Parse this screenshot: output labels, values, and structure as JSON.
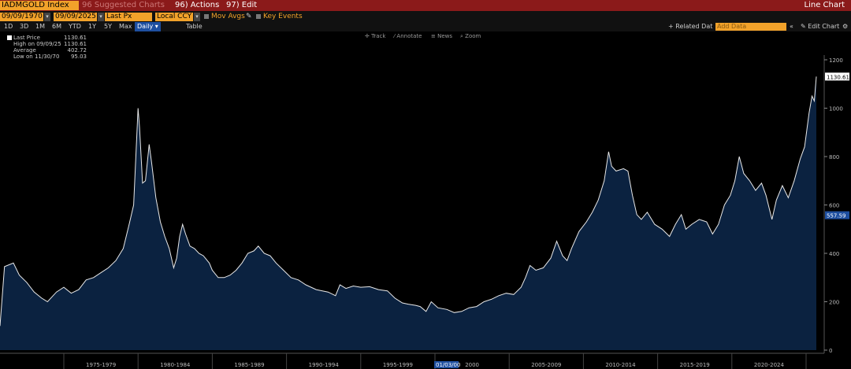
{
  "header": {
    "ticker": "IADMGOLD Index",
    "suggested": "96 Suggested Charts",
    "actions": "96) Actions",
    "edit": "97) Edit",
    "view_title": "Line Chart"
  },
  "controls": {
    "start_date": "09/09/1970",
    "end_date": "09/09/2025",
    "field": "Last Px",
    "currency": "Local CCY",
    "mov_avgs": "Mov Avgs",
    "key_events": "Key Events",
    "ranges": [
      "1D",
      "3D",
      "1M",
      "6M",
      "YTD",
      "1Y",
      "5Y",
      "Max"
    ],
    "frequency": "Daily",
    "table": "Table",
    "related_data": "+ Related Dat",
    "add_data_placeholder": "Add Data",
    "edit_chart": "Edit Chart"
  },
  "chart_tools": [
    "Track",
    "Annotate",
    "News",
    "Zoom"
  ],
  "legend": {
    "last_price_label": "Last Price",
    "last_price": "1130.61",
    "high_label": "High on 09/09/25",
    "high": "1130.61",
    "average_label": "Average",
    "average": "402.72",
    "low_label": "Low on 11/30/70",
    "low": "95.03"
  },
  "chart_data": {
    "type": "area",
    "x_tick_labels": [
      "1975-1979",
      "1980-1984",
      "1985-1989",
      "1990-1994",
      "1995-1999",
      "2000",
      "2005-2009",
      "2010-2014",
      "2015-2019",
      "2020-2024"
    ],
    "crosshair_date": "01/03/00",
    "y_ticks": [
      0,
      200,
      400,
      600,
      800,
      1000,
      1200
    ],
    "ylim": [
      0,
      1200
    ],
    "last_value_tag": "1130.61",
    "crosshair_value_tag": "557.59",
    "series": [
      {
        "points": [
          [
            1970.7,
            100
          ],
          [
            1971.0,
            345
          ],
          [
            1971.6,
            360
          ],
          [
            1972.0,
            310
          ],
          [
            1972.5,
            280
          ],
          [
            1973.0,
            240
          ],
          [
            1973.5,
            215
          ],
          [
            1973.9,
            200
          ],
          [
            1974.5,
            240
          ],
          [
            1975.0,
            260
          ],
          [
            1975.5,
            235
          ],
          [
            1976.0,
            250
          ],
          [
            1976.5,
            290
          ],
          [
            1977.0,
            300
          ],
          [
            1977.5,
            320
          ],
          [
            1978.0,
            340
          ],
          [
            1978.5,
            370
          ],
          [
            1979.0,
            420
          ],
          [
            1979.4,
            520
          ],
          [
            1979.7,
            600
          ],
          [
            1979.85,
            800
          ],
          [
            1980.0,
            1000
          ],
          [
            1980.1,
            920
          ],
          [
            1980.3,
            690
          ],
          [
            1980.5,
            700
          ],
          [
            1980.75,
            850
          ],
          [
            1980.9,
            780
          ],
          [
            1981.2,
            630
          ],
          [
            1981.5,
            530
          ],
          [
            1981.8,
            470
          ],
          [
            1982.1,
            420
          ],
          [
            1982.4,
            340
          ],
          [
            1982.6,
            380
          ],
          [
            1982.8,
            470
          ],
          [
            1983.0,
            520
          ],
          [
            1983.2,
            480
          ],
          [
            1983.5,
            430
          ],
          [
            1983.8,
            420
          ],
          [
            1984.1,
            400
          ],
          [
            1984.4,
            390
          ],
          [
            1984.8,
            360
          ],
          [
            1985.0,
            330
          ],
          [
            1985.4,
            300
          ],
          [
            1985.8,
            300
          ],
          [
            1986.2,
            310
          ],
          [
            1986.6,
            330
          ],
          [
            1987.0,
            360
          ],
          [
            1987.4,
            400
          ],
          [
            1987.8,
            410
          ],
          [
            1988.1,
            430
          ],
          [
            1988.5,
            400
          ],
          [
            1988.9,
            390
          ],
          [
            1989.3,
            360
          ],
          [
            1989.8,
            330
          ],
          [
            1990.3,
            300
          ],
          [
            1990.8,
            290
          ],
          [
            1991.3,
            270
          ],
          [
            1992.0,
            250
          ],
          [
            1992.8,
            240
          ],
          [
            1993.3,
            225
          ],
          [
            1993.6,
            270
          ],
          [
            1994.0,
            255
          ],
          [
            1994.5,
            265
          ],
          [
            1995.0,
            260
          ],
          [
            1995.6,
            262
          ],
          [
            1996.2,
            250
          ],
          [
            1996.8,
            245
          ],
          [
            1997.3,
            215
          ],
          [
            1997.8,
            195
          ],
          [
            1998.2,
            190
          ],
          [
            1998.7,
            185
          ],
          [
            1999.0,
            180
          ],
          [
            1999.4,
            160
          ],
          [
            1999.75,
            200
          ],
          [
            2000.2,
            175
          ],
          [
            2000.8,
            168
          ],
          [
            2001.3,
            155
          ],
          [
            2001.8,
            160
          ],
          [
            2002.3,
            175
          ],
          [
            2002.8,
            180
          ],
          [
            2003.3,
            200
          ],
          [
            2003.8,
            210
          ],
          [
            2004.3,
            225
          ],
          [
            2004.8,
            235
          ],
          [
            2005.3,
            230
          ],
          [
            2005.8,
            260
          ],
          [
            2006.1,
            300
          ],
          [
            2006.4,
            350
          ],
          [
            2006.8,
            330
          ],
          [
            2007.3,
            340
          ],
          [
            2007.8,
            380
          ],
          [
            2008.2,
            450
          ],
          [
            2008.6,
            390
          ],
          [
            2008.9,
            370
          ],
          [
            2009.2,
            420
          ],
          [
            2009.7,
            490
          ],
          [
            2010.2,
            530
          ],
          [
            2010.6,
            570
          ],
          [
            2011.0,
            620
          ],
          [
            2011.4,
            700
          ],
          [
            2011.7,
            820
          ],
          [
            2011.9,
            760
          ],
          [
            2012.2,
            740
          ],
          [
            2012.7,
            750
          ],
          [
            2013.0,
            740
          ],
          [
            2013.3,
            640
          ],
          [
            2013.6,
            560
          ],
          [
            2013.9,
            540
          ],
          [
            2014.3,
            570
          ],
          [
            2014.8,
            520
          ],
          [
            2015.3,
            500
          ],
          [
            2015.8,
            470
          ],
          [
            2016.2,
            520
          ],
          [
            2016.6,
            560
          ],
          [
            2016.9,
            500
          ],
          [
            2017.3,
            520
          ],
          [
            2017.8,
            540
          ],
          [
            2018.3,
            530
          ],
          [
            2018.7,
            480
          ],
          [
            2019.1,
            520
          ],
          [
            2019.5,
            600
          ],
          [
            2019.9,
            640
          ],
          [
            2020.2,
            700
          ],
          [
            2020.5,
            800
          ],
          [
            2020.8,
            730
          ],
          [
            2021.2,
            700
          ],
          [
            2021.6,
            660
          ],
          [
            2022.0,
            690
          ],
          [
            2022.3,
            640
          ],
          [
            2022.7,
            540
          ],
          [
            2023.0,
            620
          ],
          [
            2023.4,
            680
          ],
          [
            2023.8,
            630
          ],
          [
            2024.2,
            700
          ],
          [
            2024.6,
            790
          ],
          [
            2024.9,
            840
          ],
          [
            2025.2,
            980
          ],
          [
            2025.4,
            1050
          ],
          [
            2025.55,
            1030
          ],
          [
            2025.69,
            1130.61
          ]
        ]
      }
    ]
  },
  "colors": {
    "area_fill": "#0b2240",
    "line": "#e8e8e8",
    "header_bg": "#8b1a1a",
    "accent": "#f2a22a"
  }
}
